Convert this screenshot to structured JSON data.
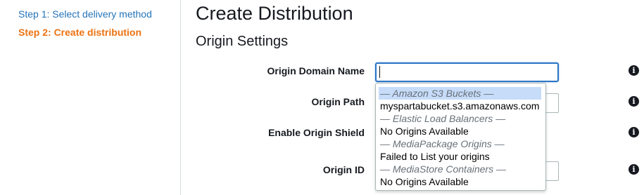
{
  "sidebar": {
    "steps": [
      {
        "label": "Step 1: Select delivery method"
      },
      {
        "label": "Step 2: Create distribution"
      }
    ]
  },
  "page": {
    "title": "Create Distribution",
    "section_title": "Origin Settings"
  },
  "form": {
    "origin_domain_name": {
      "label": "Origin Domain Name",
      "value": ""
    },
    "origin_path": {
      "label": "Origin Path",
      "value": ""
    },
    "enable_origin_shield": {
      "label": "Enable Origin Shield"
    },
    "origin_id": {
      "label": "Origin ID",
      "value": ""
    }
  },
  "dropdown": {
    "groups": [
      {
        "header": "— Amazon S3 Buckets —",
        "option": "myspartabucket.s3.amazonaws.com"
      },
      {
        "header": "— Elastic Load Balancers —",
        "option": "No Origins Available"
      },
      {
        "header": "— MediaPackage Origins —",
        "option": "Failed to List your origins"
      },
      {
        "header": "— MediaStore Containers —",
        "option": "No Origins Available"
      }
    ]
  },
  "icons": {
    "info": "info-icon"
  },
  "colors": {
    "link": "#2574b8",
    "active_step": "#ec7211",
    "focus_border": "#2a74c6",
    "highlight": "#c6dcf9"
  }
}
